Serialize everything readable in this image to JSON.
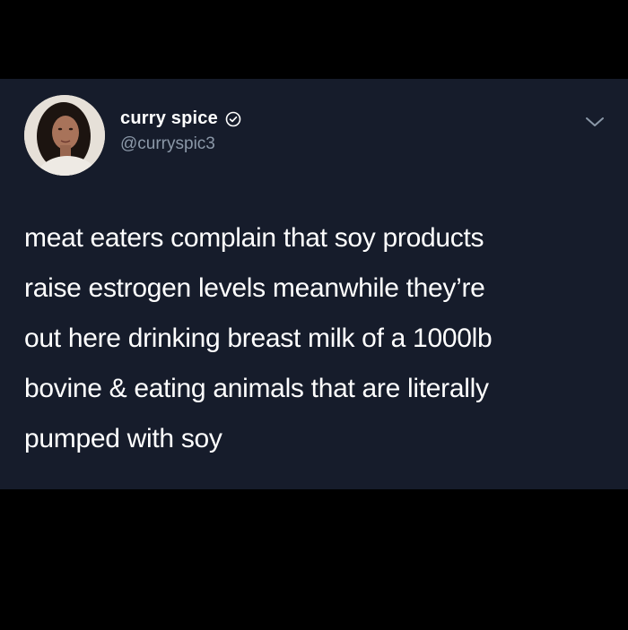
{
  "tweet": {
    "display_name": "curry spice",
    "handle": "@curryspic3",
    "verified": true,
    "text_lines": [
      "meat eaters complain that soy products",
      "raise estrogen levels meanwhile they’re",
      "out here drinking breast milk of a 1000lb",
      "bovine & eating animals that are literally",
      "pumped with soy"
    ]
  },
  "icons": {
    "verified": "verified-badge-icon",
    "menu": "chevron-down-icon",
    "avatar": "profile-photo"
  },
  "colors": {
    "page_background": "#000000",
    "card_background": "#161c2b",
    "text_primary": "#ffffff",
    "text_secondary": "#8b98a8"
  }
}
